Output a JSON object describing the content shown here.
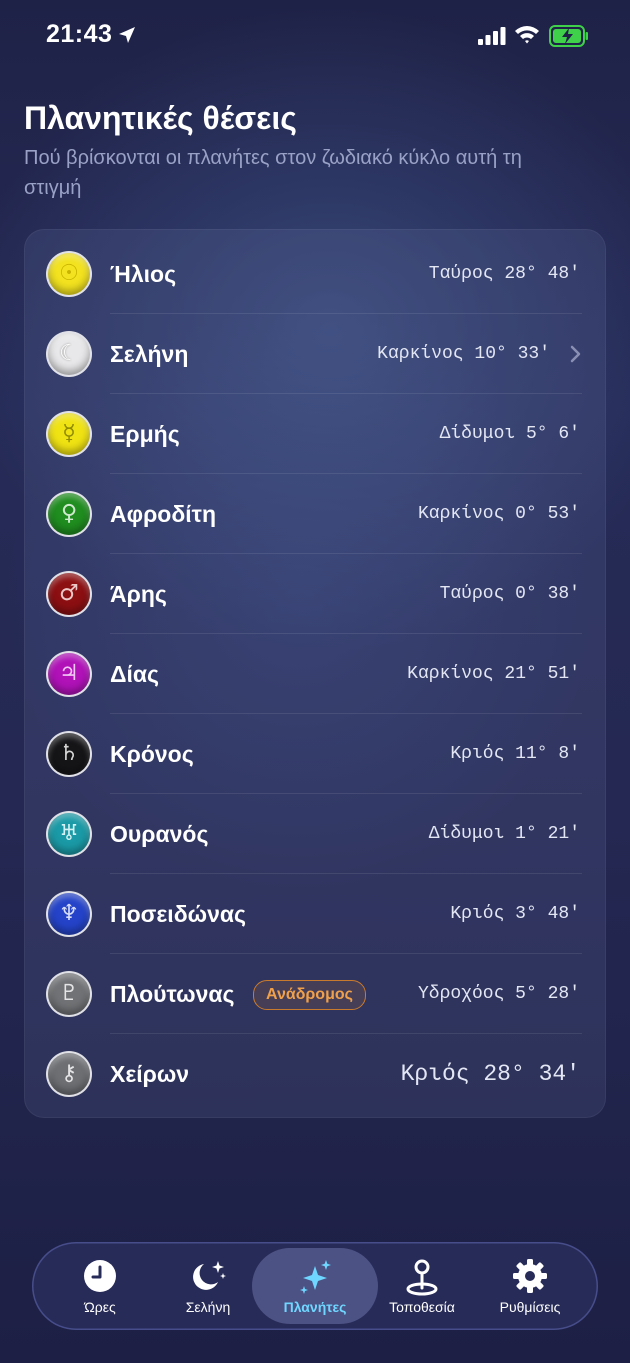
{
  "status_bar": {
    "time": "21:43"
  },
  "header": {
    "title": "Πλανητικές θέσεις",
    "subtitle": "Πού βρίσκονται οι πλανήτες στον ζωδιακό κύκλο αυτή τη στιγμή"
  },
  "planets": [
    {
      "name": "Ήλιος",
      "position": "Ταύρος 28° 48'",
      "icon": "sun-icon",
      "symbol": "☉",
      "color": "#f2e21f"
    },
    {
      "name": "Σελήνη",
      "position": "Καρκίνος 10° 33'",
      "icon": "moon-icon",
      "symbol": "☾",
      "color": "#e8e8ea"
    },
    {
      "name": "Ερμής",
      "position": "Δίδυμοι 5° 6'",
      "icon": "mercury-icon",
      "symbol": "☿",
      "color": "#f0e313"
    },
    {
      "name": "Αφροδίτη",
      "position": "Καρκίνος 0° 53'",
      "icon": "venus-icon",
      "symbol": "♀",
      "color": "#1f8d1f"
    },
    {
      "name": "Άρης",
      "position": "Ταύρος 0° 38'",
      "icon": "mars-icon",
      "symbol": "♂",
      "color": "#8c0f12"
    },
    {
      "name": "Δίας",
      "position": "Καρκίνος 21° 51'",
      "icon": "jupiter-icon",
      "symbol": "♃",
      "color": "#b012b8"
    },
    {
      "name": "Κρόνος",
      "position": "Κριός 11° 8'",
      "icon": "saturn-icon",
      "symbol": "♄",
      "color": "#151518"
    },
    {
      "name": "Ουρανός",
      "position": "Δίδυμοι 1° 21'",
      "icon": "uranus-icon",
      "symbol": "♅",
      "color": "#1a9aa6"
    },
    {
      "name": "Ποσειδώνας",
      "position": "Κριός 3° 48'",
      "icon": "neptune-icon",
      "symbol": "♆",
      "color": "#2443c8"
    },
    {
      "name": "Πλούτωνας",
      "position": "Υδροχόος 5° 28'",
      "icon": "pluto-icon",
      "symbol": "♇",
      "color": "#707275",
      "badge": "Ανάδρομος"
    },
    {
      "name": "Χείρων",
      "position": "Κριός 28° 34'",
      "icon": "chiron-icon",
      "symbol": "⚷",
      "color": "#6d6f73"
    }
  ],
  "tabs": [
    {
      "label": "Ώρες",
      "icon": "clock-icon"
    },
    {
      "label": "Σελήνη",
      "icon": "moon-stars-icon"
    },
    {
      "label": "Πλανήτες",
      "icon": "sparkles-icon",
      "active": true
    },
    {
      "label": "Τοποθεσία",
      "icon": "location-pin-icon"
    },
    {
      "label": "Ρυθμίσεις",
      "icon": "gear-icon"
    }
  ],
  "colors": {
    "accent": "#6fd7ff",
    "retrograde": "#f0a04a"
  }
}
